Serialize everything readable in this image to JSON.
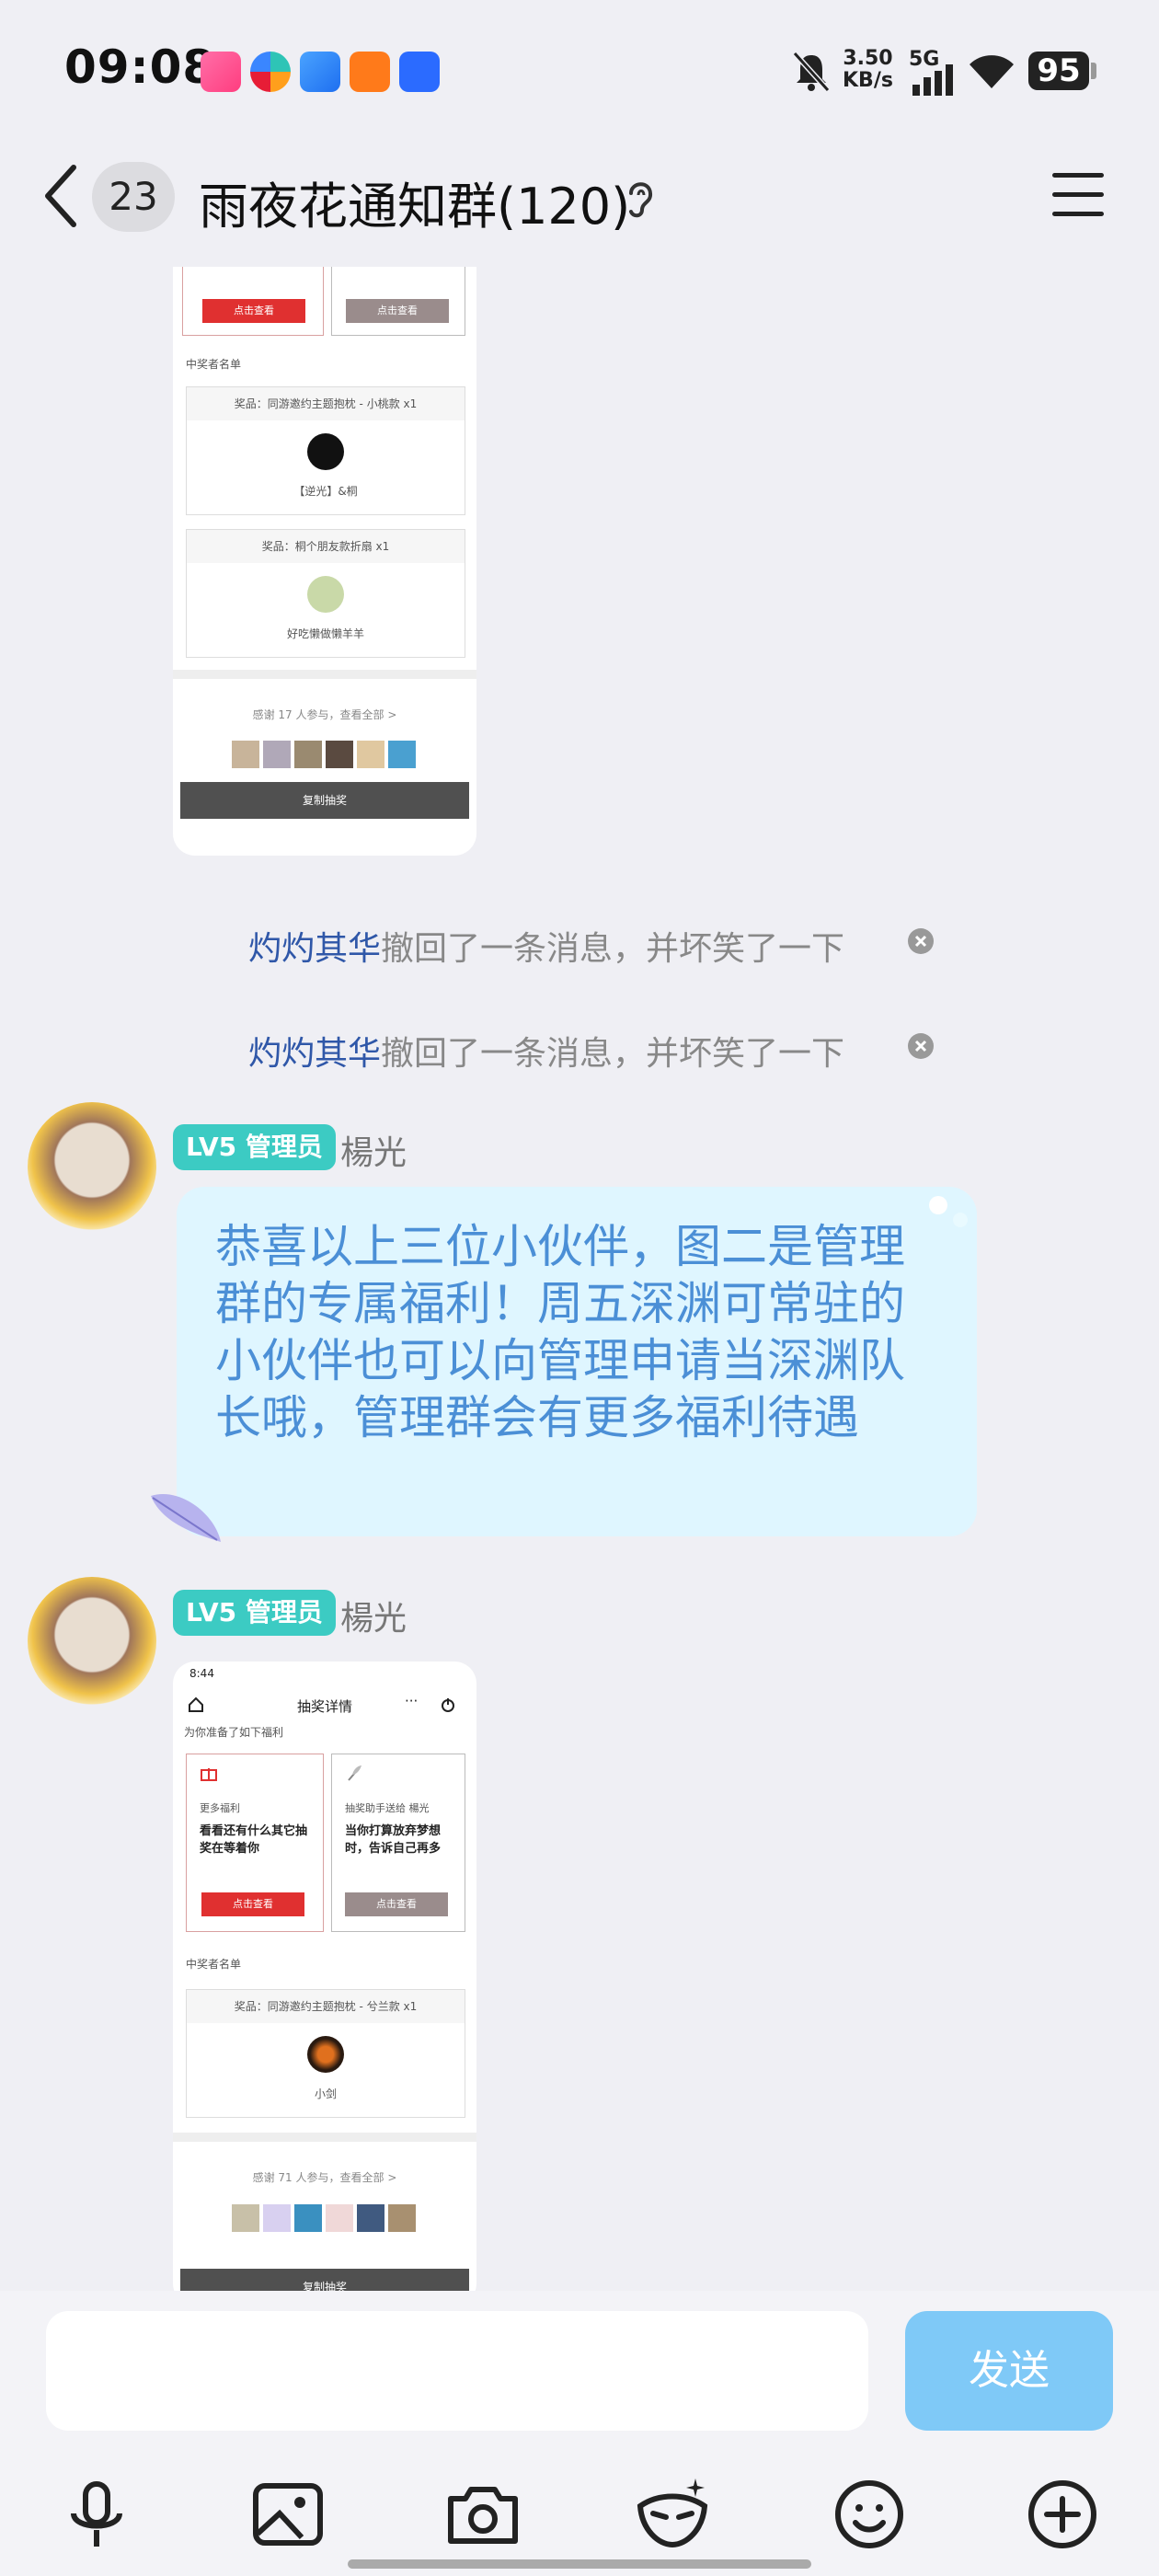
{
  "status_bar": {
    "time": "09:08",
    "net_speed_value": "3.50",
    "net_speed_unit": "KB/s",
    "network_type": "5G",
    "battery": "95",
    "icons": [
      "bilibili-app-icon",
      "colorful-app-icon",
      "blue-app-icon",
      "orange-app-icon",
      "baidu-app-icon",
      "mute-bell-icon",
      "signal-icon",
      "wifi-icon",
      "battery-icon"
    ]
  },
  "header": {
    "unread_count": "23",
    "group_title": "雨夜花通知群(120)",
    "icons": [
      "back-icon",
      "ear-icon",
      "menu-icon"
    ]
  },
  "card1": {
    "button_red": "点击查看",
    "button_gray": "点击查看",
    "winners_heading": "中奖者名单",
    "prize1_label": "奖品：同游邀约主题抱枕 - 小桃款 x1",
    "prize1_winner": "【逆光】&桐",
    "prize2_label": "奖品：桐个朋友款折扇 x1",
    "prize2_winner": "好吃懒做懒羊羊",
    "thanks_text": "感谢 17 人参与，查看全部 >",
    "copy_button": "复制抽奖"
  },
  "recalls": [
    {
      "who": "灼灼其华",
      "text": "撤回了一条消息，并坏笑了一下"
    },
    {
      "who": "灼灼其华",
      "text": "撤回了一条消息，并坏笑了一下"
    }
  ],
  "message1": {
    "badge": "LV5 管理员",
    "sender": "楊光",
    "text": "恭喜以上三位小伙伴，图二是管理群的专属福利！周五深渊可常驻的小伙伴也可以向管理申请当深渊队长哦，管理群会有更多福利待遇"
  },
  "message2": {
    "badge": "LV5 管理员",
    "sender": "楊光",
    "card": {
      "time": "8:44",
      "title": "抽奖详情",
      "more_label": "为你准备了如下福利",
      "left_small": "更多福利",
      "left_text": "看看还有什么其它抽奖在等着你",
      "left_button": "点击查看",
      "right_small": "抽奖助手送给 楊光",
      "right_text": "当你打算放弃梦想时，告诉自己再多",
      "right_button": "点击查看",
      "winners_heading": "中奖者名单",
      "prize_label": "奖品：同游邀约主题抱枕 - 兮兰款 x1",
      "prize_winner": "小剑",
      "thanks_text": "感谢 71 人参与，查看全部 >",
      "copy_button": "复制抽奖"
    }
  },
  "input": {
    "placeholder": "",
    "send_label": "发送"
  },
  "toolbar": {
    "icons": [
      "microphone-icon",
      "image-icon",
      "camera-icon",
      "mask-icon",
      "emoji-icon",
      "plus-icon"
    ]
  },
  "colors": {
    "badge": "#3ccbc3",
    "bubble_bg": "#dff6ff",
    "bubble_text": "#4b8fd6",
    "send_button": "#7fc9f7",
    "recall_name": "#2f57a8"
  }
}
